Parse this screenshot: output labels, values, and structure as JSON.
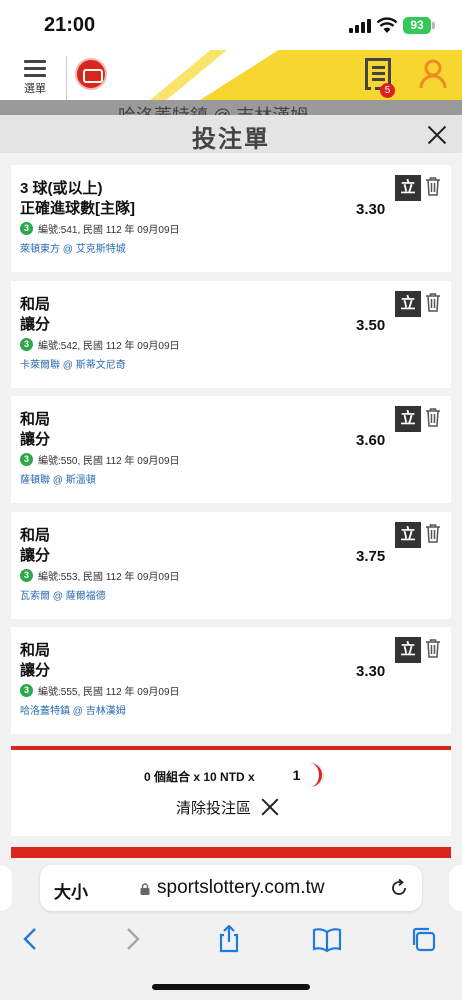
{
  "status": {
    "time": "21:00",
    "battery": "93"
  },
  "header": {
    "menu_label": "選單",
    "receipt_badge": "5"
  },
  "background": {
    "peek_text": "哈洛蓋特鎮 @ 吉林漢姆"
  },
  "sheet": {
    "title": "投注單"
  },
  "bets": [
    {
      "selection": "3 球(或以上)",
      "market": "正確進球數[主隊]",
      "odds": "3.30",
      "sport_icon": "3",
      "meta": "編號:541, 民國 112 年 09月09日",
      "teams": "萊頓東方 @ 艾克斯特城",
      "instant": "立"
    },
    {
      "selection": "和局",
      "market": "讓分",
      "odds": "3.50",
      "sport_icon": "3",
      "meta": "編號:542, 民國 112 年 09月09日",
      "teams": "卡萊爾聯 @ 斯蒂文尼奇",
      "instant": "立"
    },
    {
      "selection": "和局",
      "market": "讓分",
      "odds": "3.60",
      "sport_icon": "3",
      "meta": "編號:550, 民國 112 年 09月09日",
      "teams": "薩頓聯 @ 斯溫頓",
      "instant": "立"
    },
    {
      "selection": "和局",
      "market": "讓分",
      "odds": "3.75",
      "sport_icon": "3",
      "meta": "編號:553, 民國 112 年 09月09日",
      "teams": "瓦索爾 @ 薩爾福德",
      "instant": "立"
    },
    {
      "selection": "和局",
      "market": "讓分",
      "odds": "3.30",
      "sport_icon": "3",
      "meta": "編號:555, 民國 112 年 09月09日",
      "teams": "哈洛蓋特鎮 @ 吉林漢姆",
      "instant": "立"
    }
  ],
  "summary": {
    "combo_text": "0 個組合 x 10 NTD x",
    "stake_value": "1",
    "clear_label": "清除投注區"
  },
  "browser": {
    "aa_label": "大小",
    "url": "sportslottery.com.tw"
  },
  "colors": {
    "accent_red": "#d9261c",
    "header_yellow": "#f7d630",
    "user_orange": "#f08a24",
    "sport_green": "#2aa84a",
    "link_blue": "#2b6cb0"
  }
}
